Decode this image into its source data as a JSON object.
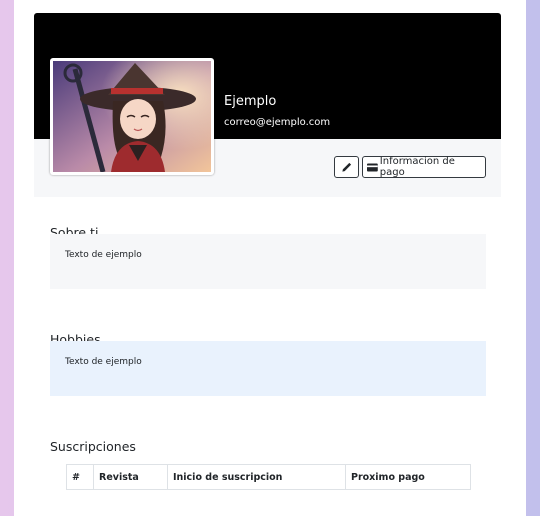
{
  "profile": {
    "name": "Ejemplo",
    "email": "correo@ejemplo.com"
  },
  "actions": {
    "edit_icon": "pencil-icon",
    "payment_icon": "credit-card-icon",
    "payment_label": "Informacion de pago"
  },
  "about": {
    "title": "Sobre ti",
    "text": "Texto de ejemplo"
  },
  "hobbies": {
    "title": "Hobbies",
    "text": "Texto de ejemplo"
  },
  "subscriptions": {
    "title": "Suscripciones",
    "columns": [
      "#",
      "Revista",
      "Inicio de suscripcion",
      "Proximo pago"
    ]
  },
  "colors": {
    "header_bg": "#000000",
    "hobbies_bg": "#e9f2fd",
    "about_bg": "#f6f7f9"
  }
}
